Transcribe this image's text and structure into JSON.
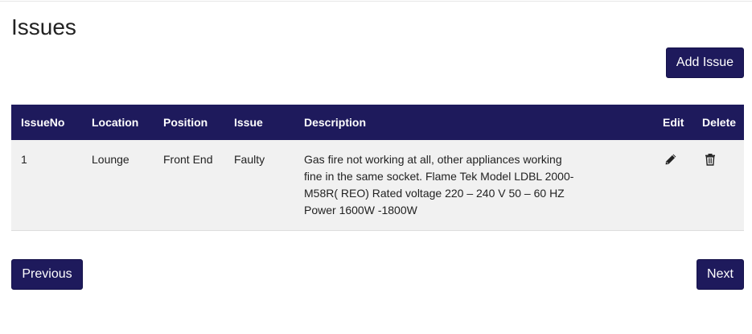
{
  "page": {
    "title": "Issues"
  },
  "toolbar": {
    "add_label": "Add Issue"
  },
  "table": {
    "headers": {
      "issue_no": "IssueNo",
      "location": "Location",
      "position": "Position",
      "issue": "Issue",
      "description": "Description",
      "edit": "Edit",
      "delete": "Delete"
    },
    "rows": [
      {
        "issue_no": "1",
        "location": "Lounge",
        "position": "Front End",
        "issue": "Faulty",
        "description": "Gas fire not working at all, other appliances working fine in the same socket. Flame Tek Model LDBL 2000-M58R( REO) Rated voltage 220 – 240 V 50 – 60 HZ Power 1600W -1800W",
        "edit_icon": "pencil-icon",
        "delete_icon": "trash-icon"
      }
    ]
  },
  "pagination": {
    "previous_label": "Previous",
    "next_label": "Next"
  },
  "colors": {
    "primary": "#1e1a5c",
    "row_background": "#f1f1f1"
  }
}
